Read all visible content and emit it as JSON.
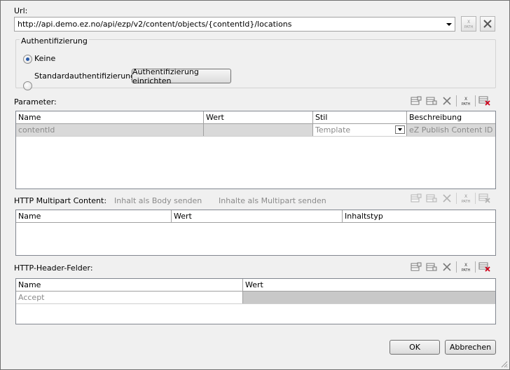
{
  "url_section": {
    "label": "Url:",
    "value": "http://api.demo.ez.no/api/ezp/v2/content/objects/{contentId}/locations"
  },
  "auth": {
    "title": "Authentifizierung",
    "option_none": "Keine",
    "option_standard": "Standardauthentifizierung",
    "setup_button": "Authentifizierung einrichten",
    "selected": "Keine"
  },
  "parameters": {
    "label": "Parameter:",
    "columns": [
      "Name",
      "Wert",
      "Stil",
      "Beschreibung"
    ],
    "rows": [
      {
        "name": "contentId",
        "wert": "",
        "stil": "Template",
        "beschreibung": "eZ Publish Content ID"
      }
    ]
  },
  "multipart": {
    "label": "HTTP Multipart Content:",
    "option_body": "Inhalt als Body senden",
    "option_multipart": "Inhalte als Multipart senden",
    "columns": [
      "Name",
      "Wert",
      "Inhaltstyp"
    ]
  },
  "headers": {
    "label": "HTTP-Header-Felder:",
    "columns": [
      "Name",
      "Wert"
    ],
    "rows": [
      {
        "name": "Accept",
        "wert": ""
      }
    ]
  },
  "footer": {
    "ok": "OK",
    "cancel": "Abbrechen"
  },
  "icon_text": {
    "xpath_top": "X",
    "xpath_bottom": "PATH"
  },
  "colors": {
    "window_bg": "#f0f0f0",
    "selected_row": "#d9d9d9",
    "delete_red": "#d0021b"
  }
}
